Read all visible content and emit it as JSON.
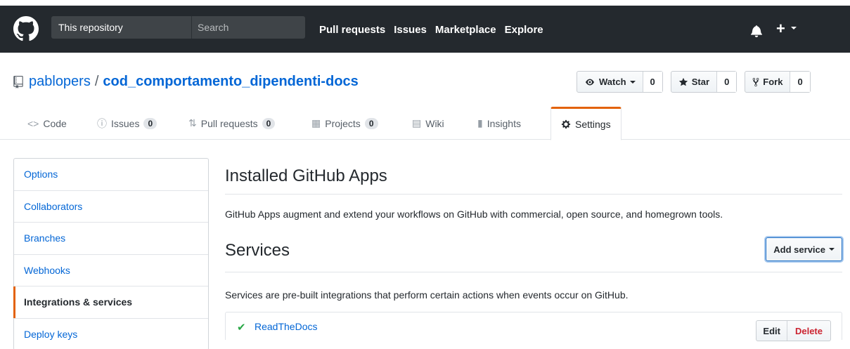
{
  "header": {
    "search_scope": "This repository",
    "search_placeholder": "Search",
    "nav": [
      "Pull requests",
      "Issues",
      "Marketplace",
      "Explore"
    ],
    "plus": "+"
  },
  "repo": {
    "owner": "pablopers",
    "separator": "/",
    "name": "cod_comportamento_dipendenti-docs"
  },
  "actions": {
    "watch_label": "Watch",
    "watch_count": "0",
    "star_label": "Star",
    "star_count": "0",
    "fork_label": "Fork",
    "fork_count": "0"
  },
  "tabs": {
    "code": "Code",
    "issues": "Issues",
    "issues_count": "0",
    "pulls": "Pull requests",
    "pulls_count": "0",
    "projects": "Projects",
    "projects_count": "0",
    "wiki": "Wiki",
    "insights": "Insights",
    "settings": "Settings"
  },
  "sidebar": {
    "items": [
      "Options",
      "Collaborators",
      "Branches",
      "Webhooks",
      "Integrations & services",
      "Deploy keys"
    ],
    "selected": "Integrations & services"
  },
  "main": {
    "installed_title": "Installed GitHub Apps",
    "installed_desc": "GitHub Apps augment and extend your workflows on GitHub with commercial, open source, and homegrown tools.",
    "services_title": "Services",
    "add_service_label": "Add service",
    "services_desc": "Services are pre-built integrations that perform certain actions when events occur on GitHub.",
    "service_name": "ReadTheDocs",
    "edit_label": "Edit",
    "delete_label": "Delete"
  },
  "colors": {
    "header_bg": "#24292e",
    "link": "#0366d6",
    "accent": "#e36209",
    "success": "#28a745",
    "danger": "#cb2431"
  }
}
